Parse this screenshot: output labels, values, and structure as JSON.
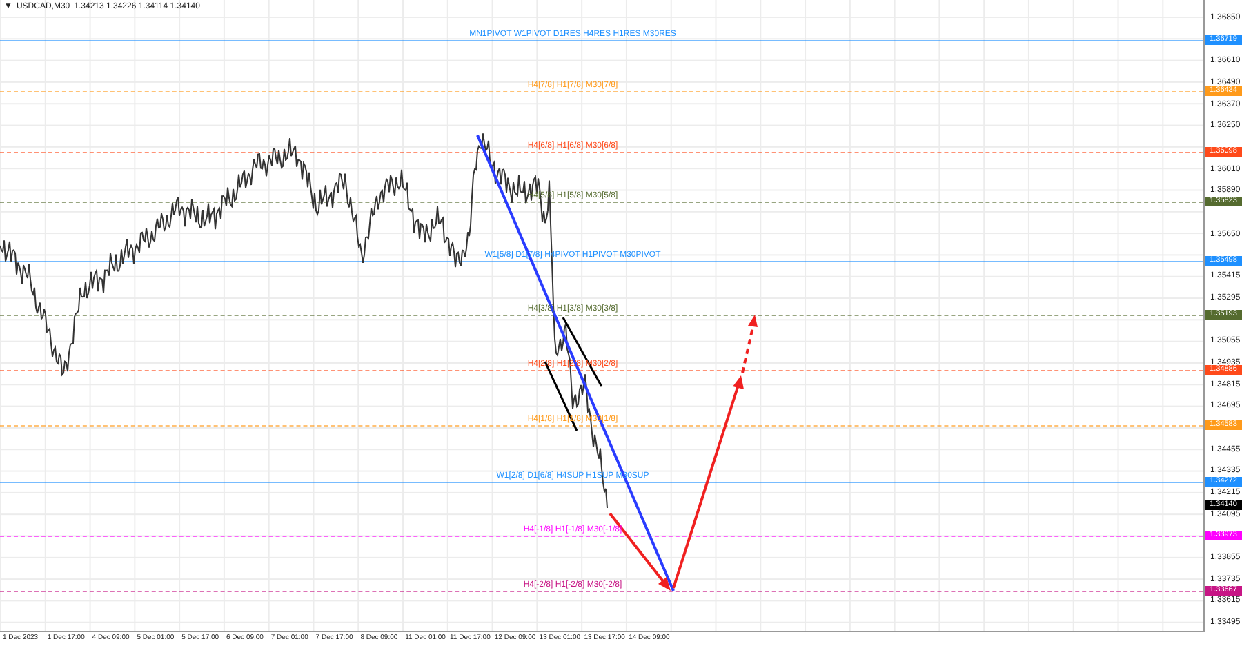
{
  "header": {
    "menu_glyph": "▼",
    "symbol": "USDCAD,M30",
    "quote": "1.34213 1.34226 1.34114 1.34140"
  },
  "levels": [
    {
      "label": "MN1PIVOT W1PIVOT D1RES H4RES H1RES M30RES",
      "price": "1.36719",
      "color": "#1e90ff",
      "kind": "solid"
    },
    {
      "label": "H4[7/8] H1[7/8] M30[7/8]",
      "price": "1.36434",
      "color": "#ff9a1a",
      "kind": "dashed"
    },
    {
      "label": "H4[6/8] H1[6/8] M30[6/8]",
      "price": "1.36098",
      "color": "#ff4a1a",
      "kind": "dashed"
    },
    {
      "label": "H4[5/8] H1[5/8] M30[5/8]",
      "price": "1.35823",
      "color": "#556b2f",
      "kind": "dashed"
    },
    {
      "label": "W1[5/8] D1[7/8] H4PIVOT H1PIVOT M30PIVOT",
      "price": "1.35498",
      "color": "#1e90ff",
      "kind": "solid"
    },
    {
      "label": "H4[3/8] H1[3/8] M30[3/8]",
      "price": "1.35193",
      "color": "#556b2f",
      "kind": "dashed"
    },
    {
      "label": "H4[2/8] H1[2/8] M30[2/8]",
      "price": "1.34886",
      "color": "#ff4a1a",
      "kind": "dashed"
    },
    {
      "label": "H4[1/8] H1[1/8] M30[1/8]",
      "price": "1.34583",
      "color": "#ff9a1a",
      "kind": "dashed"
    },
    {
      "label": "W1[2/8] D1[6/8] H4SUP H1SUP M30SUP",
      "price": "1.34272",
      "color": "#1e90ff",
      "kind": "solid"
    },
    {
      "label": "H4[-1/8] H1[-1/8] M30[-1/8]",
      "price": "1.33973",
      "color": "#ff00ff",
      "kind": "dashed"
    },
    {
      "label": "H4[-2/8] H1[-2/8] M30[-2/8]",
      "price": "1.33667",
      "color": "#c71585",
      "kind": "dashed"
    }
  ],
  "current_price": {
    "price": "1.34140"
  },
  "price_axis": {
    "ticks": [
      "1.36850",
      "1.36610",
      "1.36490",
      "1.36370",
      "1.36250",
      "1.36010",
      "1.35890",
      "1.35650",
      "1.35415",
      "1.35295",
      "1.35055",
      "1.34935",
      "1.34815",
      "1.34695",
      "1.34455",
      "1.34335",
      "1.34215",
      "1.34095",
      "1.33855",
      "1.33735",
      "1.33615",
      "1.33495"
    ]
  },
  "time_axis": {
    "labels": [
      "1 Dec 2023",
      "1 Dec 17:00",
      "4 Dec 09:00",
      "5 Dec 01:00",
      "5 Dec 17:00",
      "6 Dec 09:00",
      "7 Dec 01:00",
      "7 Dec 17:00",
      "8 Dec 09:00",
      "11 Dec 01:00",
      "11 Dec 17:00",
      "12 Dec 09:00",
      "13 Dec 01:00",
      "13 Dec 17:00",
      "14 Dec 09:00"
    ]
  }
}
